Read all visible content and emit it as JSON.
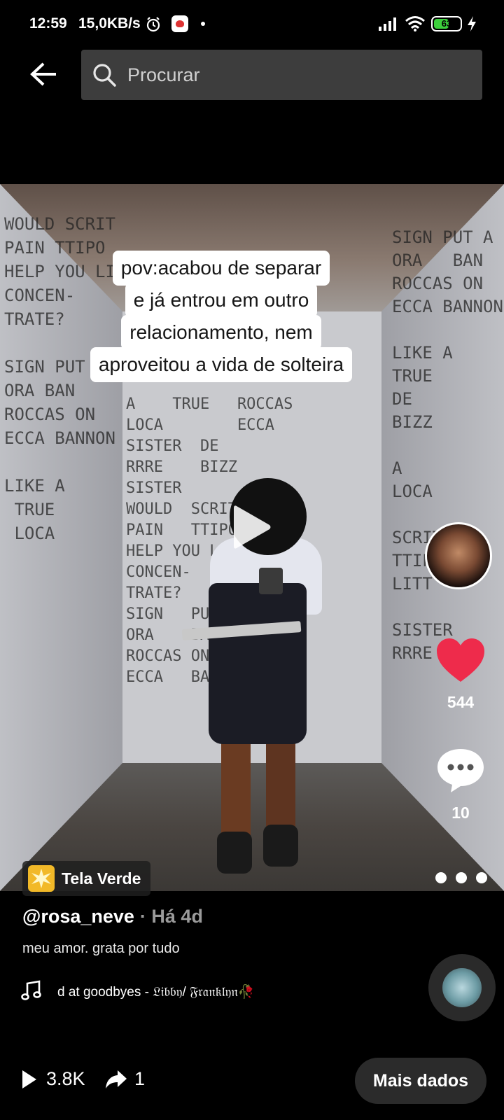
{
  "status_bar": {
    "time": "12:59",
    "network_speed": "15,0KB/s",
    "battery_level": "63",
    "battery_fraction": 0.63,
    "icons": [
      "alarm-icon",
      "app-notification-icon",
      "signal-icon",
      "wifi-icon",
      "battery-icon",
      "charging-icon"
    ]
  },
  "header": {
    "back_icon": "back-arrow-icon",
    "search_placeholder": "Procurar"
  },
  "video": {
    "caption_lines": [
      "pov:acabou de separar",
      "e já entrou em outro",
      "relacionamento, nem",
      "aproveitou a vida de solteira"
    ],
    "wall_text_left": "WOULD SCRIT\nPAIN TTIPO\nHELP YOU LITT\nCONCEN-\nTRATE?\n\nSIGN PUT A\nORA BAN\nROCCAS ON\nECCA BANNON\n\nLIKE A\n TRUE\n LOCA",
    "wall_text_back": "A    TRUE   ROCCAS\nLOCA        ECCA\nSISTER  DE\nRRRE    BIZZ\nSISTER\nWOULD  SCRIT\nPAIN   TTIPO\nHELP YOU LITT\nCONCEN-\nTRATE?\nSIGN   PUT A\nORA    BAN\nROCCAS ON\nECCA   BANNON",
    "wall_text_right": "SIGN PUT A\nORA   BAN\nROCCAS ON\nECCA BANNON\n\nLIKE A\nTRUE\nDE\nBIZZ\n\nA\nLOCA\n\nSCRIT\nTTIPO\nLITT\n\nSISTER\nRRRE",
    "accent_like": "#ee2b4b"
  },
  "actions": {
    "likes": "544",
    "comments": "10"
  },
  "effect": {
    "label": "Tela Verde"
  },
  "post": {
    "author": "@rosa_neve",
    "time": "· Há 4d",
    "description": "meu amor. grata por tudo",
    "music": "d at goodbyes - 𝔏𝔦𝔟𝔟𝔶/ 𝔉𝔯𝔞𝔫𝔨𝔩𝔶𝔫🥀"
  },
  "footer": {
    "plays": "3.8K",
    "shares": "1",
    "more_data_label": "Mais dados"
  }
}
